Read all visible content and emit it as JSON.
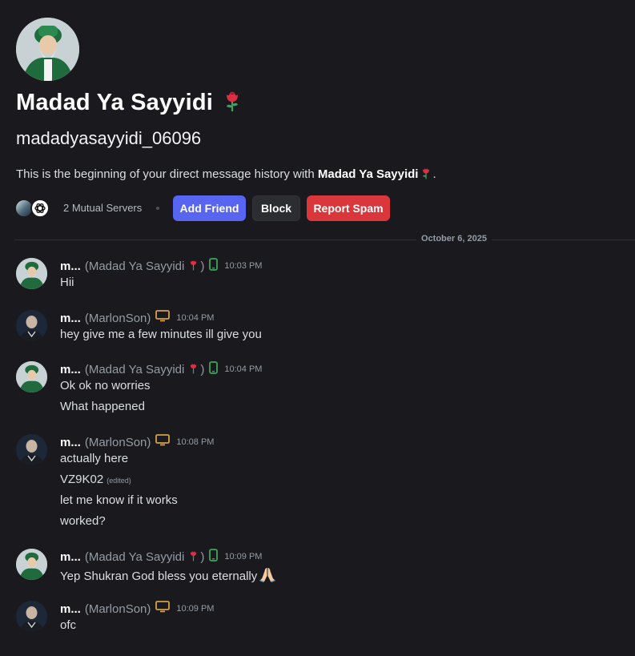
{
  "profile": {
    "display_name": "Madad Ya Sayyidi",
    "username": "madadyasayyidi_06096",
    "intro_prefix": "This is the beginning of your direct message history with ",
    "intro_name": "Madad Ya Sayyidi",
    "intro_suffix": "."
  },
  "actions": {
    "mutual_servers": "2 Mutual Servers",
    "add_friend": "Add Friend",
    "block": "Block",
    "report_spam": "Report Spam"
  },
  "date_divider": "October 6, 2025",
  "messages": [
    {
      "author": "m...",
      "alias": "(Madad Ya Sayyidi",
      "alias_end": ")",
      "device": "mobile-icon",
      "time": "10:03 PM",
      "lines": [
        "Hii"
      ]
    },
    {
      "author": "m...",
      "alias": "(MarlonSon)",
      "device": "desktop-icon",
      "time": "10:04 PM",
      "lines": [
        "hey give me a few minutes ill give you"
      ]
    },
    {
      "author": "m...",
      "alias": "(Madad Ya Sayyidi",
      "alias_end": ")",
      "device": "mobile-icon",
      "time": "10:04 PM",
      "lines": [
        "Ok ok no worries",
        "What happened"
      ]
    },
    {
      "author": "m...",
      "alias": "(MarlonSon)",
      "device": "desktop-icon",
      "time": "10:08 PM",
      "lines": [
        "actually here",
        "VZ9K02",
        "let me know if it works",
        "worked?"
      ],
      "edited": "(edited)"
    },
    {
      "author": "m...",
      "alias": "(Madad Ya Sayyidi",
      "alias_end": ")",
      "device": "mobile-icon",
      "time": "10:09 PM",
      "lines": [
        "Yep Shukran God bless you eternally"
      ]
    },
    {
      "author": "m...",
      "alias": "(MarlonSon)",
      "device": "desktop-icon",
      "time": "10:09 PM",
      "lines": [
        "ofc"
      ]
    }
  ],
  "colors": {
    "background": "#1a1a1e",
    "accent": "#5865f2",
    "danger": "#da373c",
    "mobile": "#3ba55d",
    "desktop": "#d4a04a"
  }
}
